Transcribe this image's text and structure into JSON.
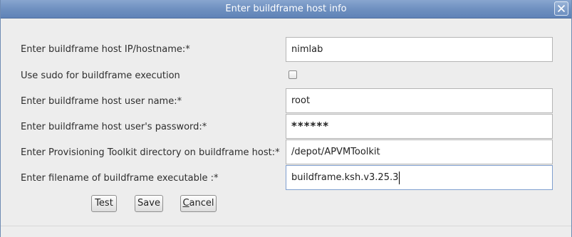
{
  "window": {
    "title": "Enter buildframe host info"
  },
  "form": {
    "rows": [
      {
        "label": "Enter buildframe host IP/hostname:*",
        "value": "nimlab"
      },
      {
        "label": "Use sudo for buildframe execution",
        "checked": false
      },
      {
        "label": "Enter buildframe host user name:*",
        "value": "root"
      },
      {
        "label": "Enter buildframe host user's password:*",
        "value": "******"
      },
      {
        "label": "Enter Provisioning Toolkit directory on buildframe host:*",
        "value": "/depot/APVMToolkit"
      },
      {
        "label": "Enter filename of buildframe executable :*",
        "value": "buildframe.ksh.v3.25.3"
      }
    ]
  },
  "buttons": {
    "test": "Test",
    "save": "Save",
    "cancel_first": "C",
    "cancel_rest": "ancel"
  },
  "icons": {
    "close": "close-icon"
  }
}
